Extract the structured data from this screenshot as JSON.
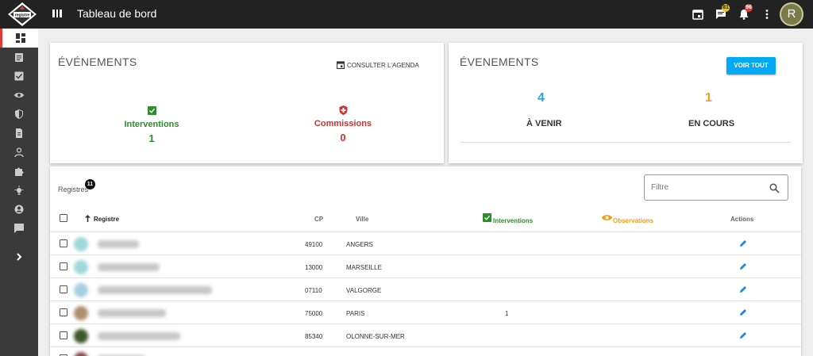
{
  "app": {
    "page_title": "Tableau de bord",
    "logo_icon": "registre-securite-logo",
    "notifications": {
      "messages_count": "81",
      "alerts_count": "96"
    },
    "avatar_letter": "R"
  },
  "sidebar": {
    "items": [
      {
        "icon": "dashboard-icon",
        "active": true
      },
      {
        "icon": "clipboard-icon"
      },
      {
        "icon": "checkbox-icon"
      },
      {
        "icon": "eye-icon"
      },
      {
        "icon": "shield-icon"
      },
      {
        "icon": "document-icon"
      },
      {
        "icon": "person-icon"
      },
      {
        "icon": "puzzle-icon"
      },
      {
        "icon": "lightbulb-icon"
      },
      {
        "icon": "account-circle-icon"
      },
      {
        "icon": "message-icon"
      },
      {
        "icon": "chevron-right-icon"
      }
    ]
  },
  "events_card": {
    "title": "ÉVÉNEMENTS",
    "agenda_link": "CONSULTER L'AGENDA",
    "interventions_label": "Interventions",
    "interventions_value": "1",
    "commissions_label": "Commissions",
    "commissions_value": "0"
  },
  "events_card2": {
    "title": "ÉVENEMENTS",
    "button_label": "VOIR TOUT",
    "upcoming_value": "4",
    "upcoming_label": "À VENIR",
    "ongoing_value": "1",
    "ongoing_label": "EN COURS"
  },
  "registres": {
    "label": "Registres",
    "count": "11",
    "filter_placeholder": "Filtre",
    "columns": {
      "registre": "Registre",
      "cp": "CP",
      "ville": "Ville",
      "interventions": "Interventions",
      "observations": "Observations",
      "actions": "Actions"
    },
    "rows": [
      {
        "cp": "49100",
        "ville": "ANGERS",
        "interventions": "",
        "avatar_color": "#9fd8d8"
      },
      {
        "cp": "13000",
        "ville": "MARSEILLE",
        "interventions": "",
        "avatar_color": "#9fd8d8"
      },
      {
        "cp": "07110",
        "ville": "VALGORGE",
        "interventions": "",
        "avatar_color": "#a8cfe0"
      },
      {
        "cp": "75000",
        "ville": "PARIS",
        "interventions": "1",
        "avatar_color": "#b08e70"
      },
      {
        "cp": "85340",
        "ville": "OLONNE-SUR-MER",
        "interventions": "",
        "avatar_color": "#3f5a2a"
      },
      {
        "cp": "",
        "ville": "",
        "interventions": "",
        "avatar_color": "#8a4a4a"
      }
    ]
  },
  "colors": {
    "accent": "#03a9f4",
    "success": "#2e8b2e",
    "danger": "#d32f2f",
    "warning": "#f39c12",
    "upcoming": "#29a3e6"
  }
}
